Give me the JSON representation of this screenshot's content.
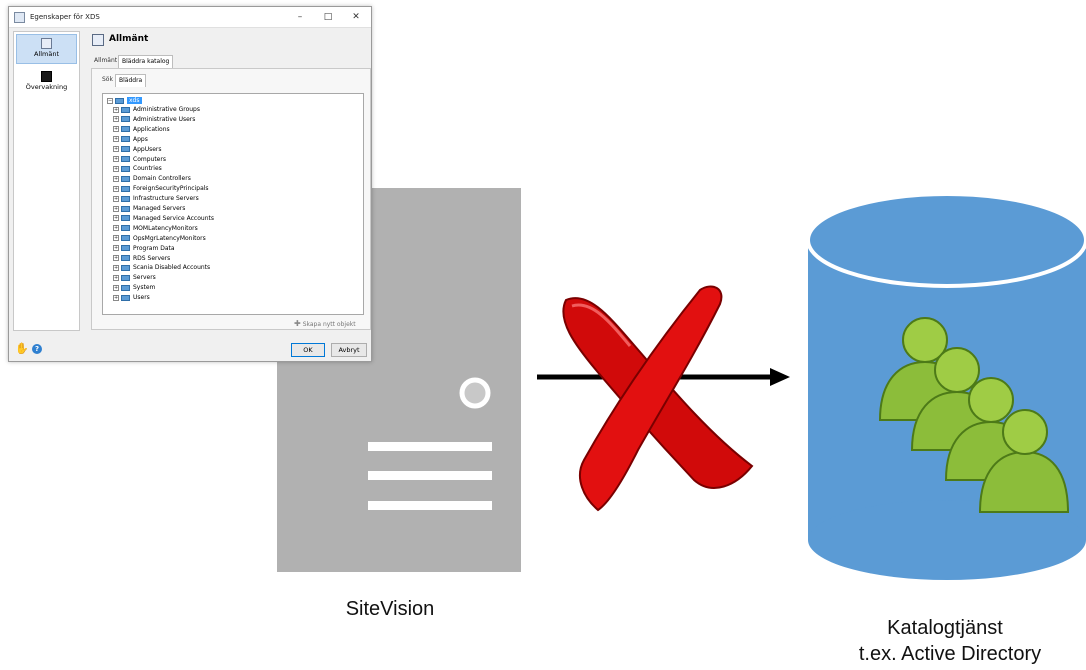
{
  "colors": {
    "server": "#b1b1b1",
    "database": "#5b9bd5",
    "database_top": "#2e75b6",
    "arrow": "#000000",
    "cross": "#c00000",
    "users": "#8cbd3a"
  },
  "labels": {
    "server": "SiteVision",
    "directory_line1": "Katalogtjänst",
    "directory_line2": "t.ex. Active Directory"
  },
  "icons": {
    "server": "server-icon",
    "database": "database-cylinder-icon",
    "users": "user-group-icon",
    "blocked": "red-cross-icon"
  },
  "dialog": {
    "title": "Egenskaper för XDS",
    "sidebar": [
      {
        "label": "Allmänt",
        "icon": "properties-icon",
        "selected": true
      },
      {
        "label": "Övervakning",
        "icon": "monitor-icon",
        "selected": false
      }
    ],
    "heading": "Allmänt",
    "tabs": [
      "Allmänt",
      "Bläddra katalog"
    ],
    "subtabs": [
      "Sök",
      "Bläddra"
    ],
    "tree_root": "xds",
    "tree_items": [
      "Administrative Groups",
      "Administrative Users",
      "Applications",
      "Apps",
      "AppUsers",
      "Computers",
      "Countries",
      "Domain Controllers",
      "ForeignSecurityPrincipals",
      "Infrastructure Servers",
      "Managed Servers",
      "Managed Service Accounts",
      "MOMLatencyMonitors",
      "OpsMgrLatencyMonitors",
      "Program Data",
      "RDS Servers",
      "Scania Disabled Accounts",
      "Servers",
      "System",
      "Users"
    ],
    "create_object": "Skapa nytt objekt",
    "ok": "OK",
    "cancel": "Avbryt"
  }
}
